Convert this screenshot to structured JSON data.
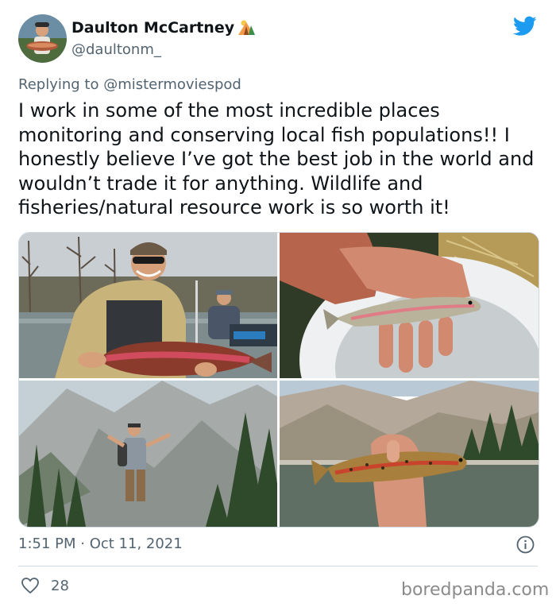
{
  "author": {
    "display_name": "Daulton McCartney",
    "handle": "@daultonm_"
  },
  "reply": {
    "prefix": "Replying to ",
    "mention": "@mistermoviespod"
  },
  "tweet": {
    "text": "I work in some of the most incredible places monitoring and conserving local fish populations!! I honestly believe I’ve got the best job in the world and wouldn’t trade it for anything. Wildlife and fisheries/natural resource work is so worth it!"
  },
  "meta": {
    "timestamp": "1:51 PM · Oct 11, 2021"
  },
  "engagement": {
    "likes": "28"
  },
  "watermark": "boredpanda.com",
  "icons": {
    "brand": "twitter-bird-icon",
    "emoji": "tent-icon",
    "info": "info-icon",
    "like": "heart-icon"
  },
  "colors": {
    "twitter_blue": "#1d9bf0",
    "secondary_text": "#536471",
    "divider": "#cfd9de"
  }
}
